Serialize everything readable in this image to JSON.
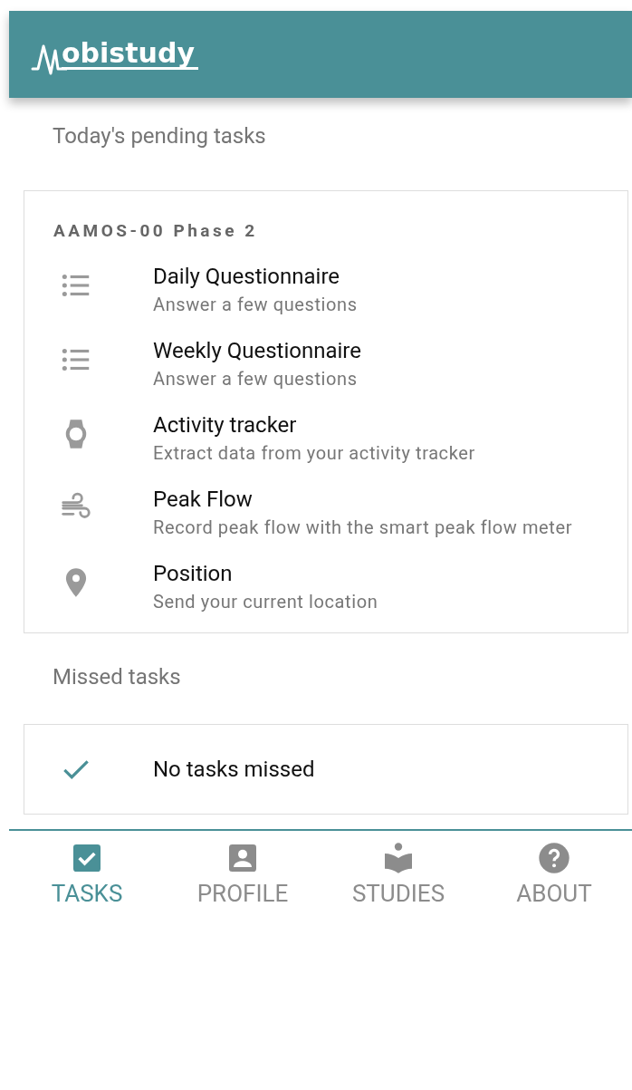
{
  "header": {
    "logo_text": "obistudy"
  },
  "pending": {
    "title": "Today's pending tasks",
    "study": "AAMOS-00 Phase 2",
    "tasks": [
      {
        "kind": "questionnaire",
        "title": "Daily Questionnaire",
        "subtitle": "Answer a few questions"
      },
      {
        "kind": "questionnaire",
        "title": "Weekly Questionnaire",
        "subtitle": "Answer a few questions"
      },
      {
        "kind": "watch",
        "title": "Activity tracker",
        "subtitle": "Extract data from your activity tracker"
      },
      {
        "kind": "wind",
        "title": "Peak Flow",
        "subtitle": "Record peak flow with the smart peak flow meter"
      },
      {
        "kind": "location",
        "title": "Position",
        "subtitle": "Send your current location"
      }
    ]
  },
  "missed": {
    "title": "Missed tasks",
    "message": "No tasks missed"
  },
  "nav": [
    {
      "kind": "tasks",
      "label": "TASKS",
      "selected": true
    },
    {
      "kind": "profile",
      "label": "PROFILE",
      "selected": false
    },
    {
      "kind": "studies",
      "label": "STUDIES",
      "selected": false
    },
    {
      "kind": "about",
      "label": "ABOUT",
      "selected": false
    }
  ]
}
